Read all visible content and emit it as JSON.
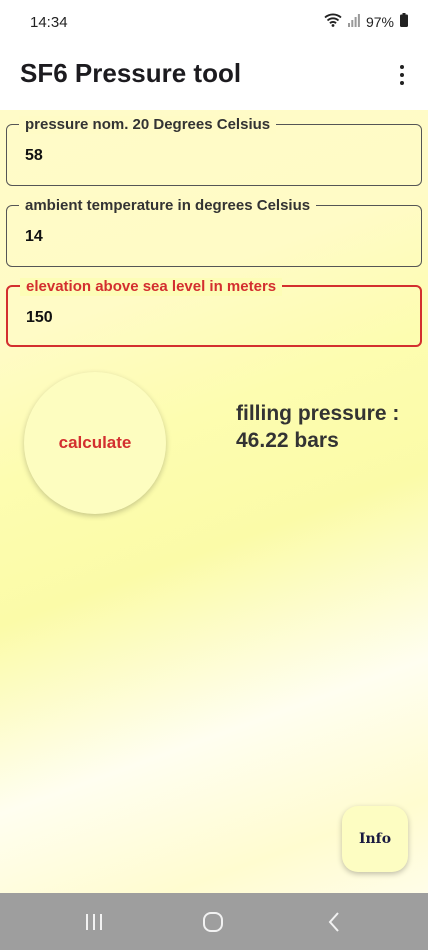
{
  "status_bar": {
    "time": "14:34",
    "battery": "97%"
  },
  "app_bar": {
    "title": "SF6 Pressure tool"
  },
  "form": {
    "fields": [
      {
        "label": "pressure nom. 20 Degrees Celsius",
        "value": "58"
      },
      {
        "label": "ambient temperature in degrees Celsius",
        "value": "14"
      },
      {
        "label": "elevation above sea level in meters",
        "value": "150"
      }
    ],
    "calculate_label": "calculate"
  },
  "result": {
    "label": "filling pressure :",
    "value": "46.22 bars"
  },
  "info_label": "Info",
  "colors": {
    "accent": "#d32f2f",
    "background_yellow": "#fdfdb0",
    "nav_bar": "#9e9e9e"
  }
}
